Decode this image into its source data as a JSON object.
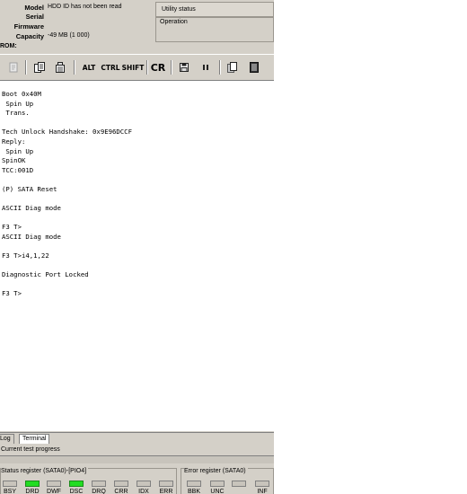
{
  "drive_info": {
    "model_label": "Model",
    "model_value": "HDD ID has not been read",
    "serial_label": "Serial",
    "firmware_label": "Firmware",
    "capacity_label": "Capacity",
    "capacity_value": "-49 MB (1 000)"
  },
  "panels": {
    "utility_status": "Utility status",
    "operation": "Operation"
  },
  "rom_label": "ROM:",
  "toolbar": {
    "alt": "ALT",
    "ctrl": "CTRL",
    "shift": "SHIFT",
    "cr": "CR",
    "icons": [
      "disabled-doc-icon",
      "copy-icon",
      "device-icon",
      "save-icon",
      "pause-icon",
      "pages-icon",
      "log-book-icon"
    ]
  },
  "terminal": {
    "lines": [
      "Boot 0x40M",
      " Spin Up",
      " Trans.",
      "",
      "Tech Unlock Handshake: 0x9E96DCCF",
      "Reply:",
      " Spin Up",
      "SpinOK",
      "TCC:001D",
      "",
      "(P) SATA Reset",
      "",
      "ASCII Diag mode",
      "",
      "F3 T>",
      "ASCII Diag mode",
      "",
      "F3 T>i4,1,22",
      "",
      "Diagnostic Port Locked",
      "",
      "F3 T>"
    ]
  },
  "tabs": [
    {
      "label": "Log",
      "active": false
    },
    {
      "label": "Terminal",
      "active": true
    }
  ],
  "progress_label": "Current test progress",
  "status_register": {
    "title": "Status register (SATA0)-[PIO4]",
    "leds": [
      {
        "label": "BSY",
        "on": false
      },
      {
        "label": "DRD",
        "on": true
      },
      {
        "label": "DWF",
        "on": false
      },
      {
        "label": "DSC",
        "on": true
      },
      {
        "label": "DRQ",
        "on": false
      },
      {
        "label": "CRR",
        "on": false
      },
      {
        "label": "IDX",
        "on": false
      },
      {
        "label": "ERR",
        "on": false
      }
    ]
  },
  "error_register": {
    "title": "Error register (SATA0)",
    "leds": [
      {
        "label": "BBK",
        "on": false
      },
      {
        "label": "UNC",
        "on": false
      },
      {
        "label": "",
        "on": false
      },
      {
        "label": "INF",
        "on": false
      }
    ]
  },
  "colors": {
    "led_on": "#22dd22",
    "panel_bg": "#d4d0c8"
  }
}
